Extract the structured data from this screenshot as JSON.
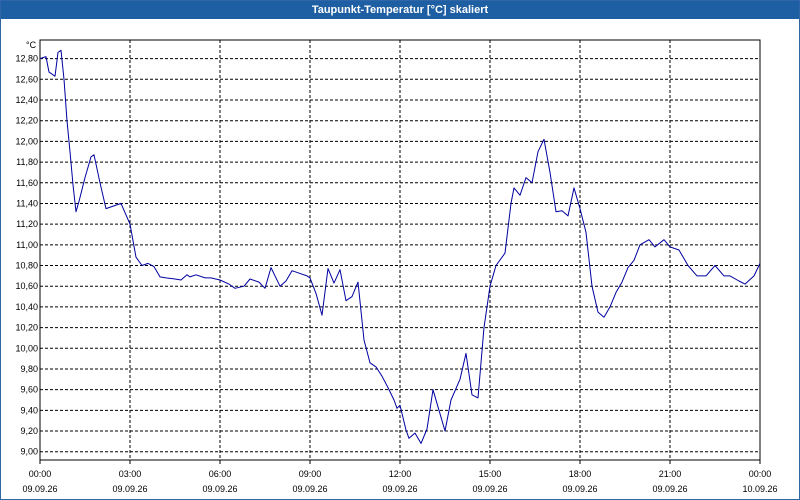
{
  "window": {
    "title": "Taupunkt-Temperatur [°C] skaliert"
  },
  "colors": {
    "titlebar": "#1e5fa3",
    "line": "#0000a0",
    "grid": "#000000"
  },
  "chart_data": {
    "type": "line",
    "title": "Taupunkt-Temperatur [°C] skaliert",
    "ylabel": "°C",
    "xlabel": "",
    "ylim": [
      8.92,
      12.98
    ],
    "grid": true,
    "y_ticks": [
      "12,80",
      "12,60",
      "12,40",
      "12,20",
      "12,00",
      "11,80",
      "11,60",
      "11,40",
      "11,20",
      "11,00",
      "10,80",
      "10,60",
      "10,40",
      "10,20",
      "10,00",
      "9,80",
      "9,60",
      "9,40",
      "9,20",
      "9,00"
    ],
    "x_ticks": [
      {
        "time": "00:00",
        "date": "09.09.26"
      },
      {
        "time": "03:00",
        "date": "09.09.26"
      },
      {
        "time": "06:00",
        "date": "09.09.26"
      },
      {
        "time": "09:00",
        "date": "09.09.26"
      },
      {
        "time": "12:00",
        "date": "09.09.26"
      },
      {
        "time": "15:00",
        "date": "09.09.26"
      },
      {
        "time": "18:00",
        "date": "09.09.26"
      },
      {
        "time": "21:00",
        "date": "09.09.26"
      },
      {
        "time": "00:00",
        "date": "10.09.26"
      }
    ],
    "x_hours": [
      0,
      0.2,
      0.3,
      0.4,
      0.5,
      0.6,
      0.7,
      0.8,
      0.9,
      1.0,
      1.1,
      1.2,
      1.3,
      1.5,
      1.7,
      1.8,
      2.0,
      2.2,
      2.5,
      2.7,
      3.0,
      3.2,
      3.4,
      3.6,
      3.8,
      4.0,
      4.2,
      4.5,
      4.7,
      4.9,
      5.0,
      5.2,
      5.5,
      5.7,
      6.0,
      6.3,
      6.5,
      6.8,
      7.0,
      7.3,
      7.5,
      7.7,
      8.0,
      8.2,
      8.4,
      8.7,
      8.9,
      9.0,
      9.2,
      9.4,
      9.6,
      9.8,
      10.0,
      10.2,
      10.4,
      10.6,
      10.8,
      11.0,
      11.2,
      11.4,
      11.6,
      11.8,
      11.9,
      12.0,
      12.2,
      12.3,
      12.5,
      12.7,
      12.9,
      13.1,
      13.3,
      13.5,
      13.7,
      14.0,
      14.2,
      14.4,
      14.6,
      14.8,
      15.0,
      15.2,
      15.5,
      15.7,
      15.8,
      16.0,
      16.2,
      16.4,
      16.6,
      16.8,
      17.0,
      17.2,
      17.4,
      17.6,
      17.8,
      18.0,
      18.2,
      18.4,
      18.6,
      18.8,
      19.0,
      19.2,
      19.4,
      19.6,
      19.8,
      20.0,
      20.3,
      20.5,
      20.8,
      21.0,
      21.3,
      21.6,
      21.9,
      22.2,
      22.5,
      22.8,
      23.0,
      23.3,
      23.5,
      23.8,
      24.0
    ],
    "series": [
      {
        "values": [
          12.8,
          12.82,
          12.67,
          12.65,
          12.63,
          12.86,
          12.88,
          12.6,
          12.2,
          11.9,
          11.58,
          11.32,
          11.42,
          11.65,
          11.85,
          11.87,
          11.6,
          11.35,
          11.38,
          11.4,
          11.2,
          10.88,
          10.8,
          10.82,
          10.79,
          10.69,
          10.68,
          10.67,
          10.66,
          10.71,
          10.69,
          10.71,
          10.68,
          10.68,
          10.66,
          10.62,
          10.58,
          10.6,
          10.67,
          10.64,
          10.58,
          10.78,
          10.6,
          10.65,
          10.75,
          10.72,
          10.7,
          10.68,
          10.53,
          10.32,
          10.77,
          10.63,
          10.76,
          10.46,
          10.5,
          10.64,
          10.08,
          9.86,
          9.82,
          9.73,
          9.62,
          9.5,
          9.42,
          9.45,
          9.21,
          9.13,
          9.18,
          9.08,
          9.22,
          9.6,
          9.4,
          9.2,
          9.5,
          9.7,
          9.95,
          9.55,
          9.52,
          10.2,
          10.6,
          10.8,
          10.92,
          11.4,
          11.55,
          11.48,
          11.65,
          11.6,
          11.9,
          12.02,
          11.7,
          11.32,
          11.33,
          11.28,
          11.55,
          11.35,
          11.12,
          10.6,
          10.35,
          10.3,
          10.4,
          10.54,
          10.64,
          10.78,
          10.85,
          11.0,
          11.05,
          10.98,
          11.05,
          10.98,
          10.95,
          10.8,
          10.7,
          10.7,
          10.8,
          10.7,
          10.7,
          10.65,
          10.62,
          10.7,
          10.82
        ]
      }
    ]
  }
}
